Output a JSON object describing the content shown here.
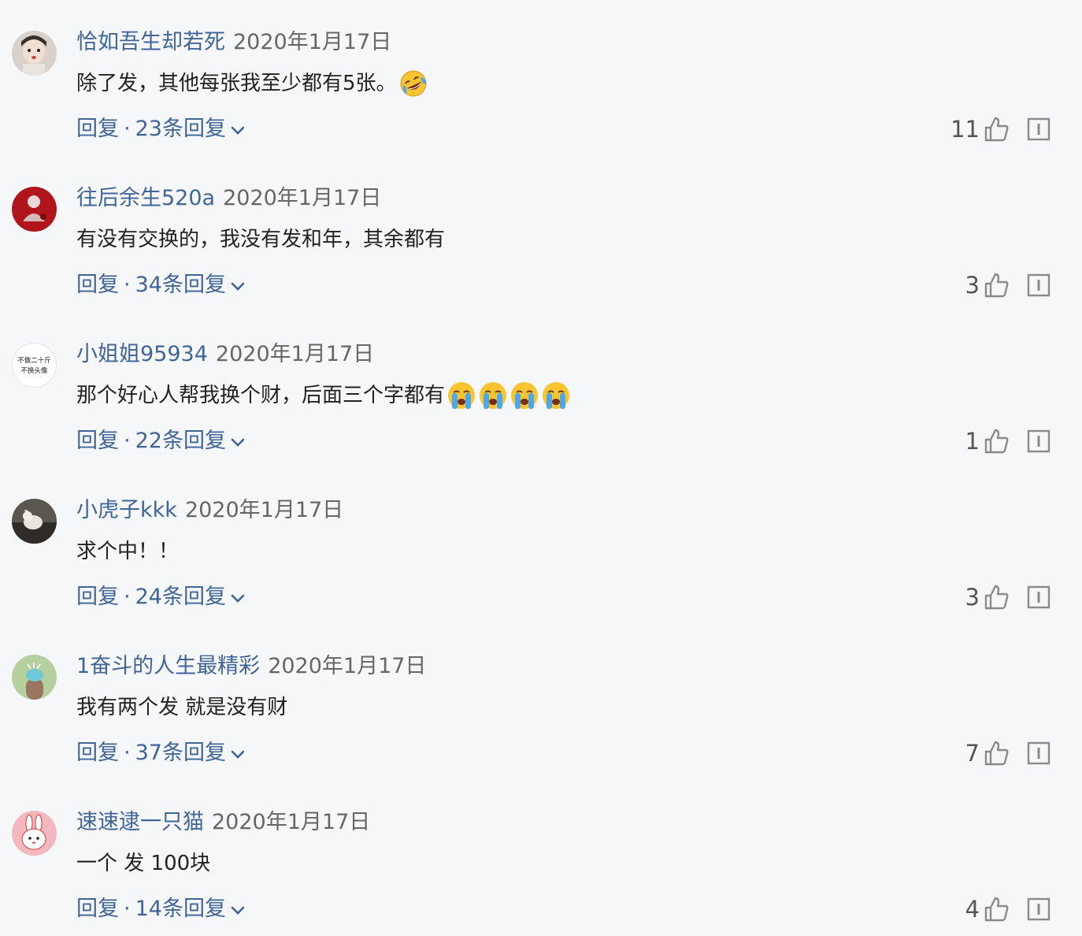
{
  "comments": [
    {
      "username": "恰如吾生却若死",
      "date": "2020年1月17日",
      "text": "除了发，其他每张我至少都有5张。",
      "emojis": [
        "laughing-crying"
      ],
      "reply_label": "回复",
      "reply_count": "23条回复",
      "likes": "11",
      "avatar_color": "#d9d2cc"
    },
    {
      "username": "往后余生520a",
      "date": "2020年1月17日",
      "text": "有没有交换的，我没有发和年，其余都有",
      "emojis": [],
      "reply_label": "回复",
      "reply_count": "34条回复",
      "likes": "3",
      "avatar_color": "#b0151b"
    },
    {
      "username": "小姐姐95934",
      "date": "2020年1月17日",
      "text": "那个好心人帮我换个财，后面三个字都有",
      "emojis": [
        "crying",
        "crying",
        "crying",
        "crying"
      ],
      "reply_label": "回复",
      "reply_count": "22条回复",
      "likes": "1",
      "avatar_text_1": "不做二十斤",
      "avatar_text_2": "不换头像",
      "avatar_color": "#ffffff"
    },
    {
      "username": "小虎子kkk",
      "date": "2020年1月17日",
      "text": "求个中！！",
      "emojis": [],
      "reply_label": "回复",
      "reply_count": "24条回复",
      "likes": "3",
      "avatar_color": "#5a5650"
    },
    {
      "username": "1奋斗的人生最精彩",
      "date": "2020年1月17日",
      "text": "我有两个发 就是没有财",
      "emojis": [],
      "reply_label": "回复",
      "reply_count": "37条回复",
      "likes": "7",
      "avatar_color": "#b6cf9e"
    },
    {
      "username": "速速逮一只猫",
      "date": "2020年1月17日",
      "text": "一个 发 100块",
      "emojis": [],
      "reply_label": "回复",
      "reply_count": "14条回复",
      "likes": "4",
      "avatar_color": "#f3b8be"
    }
  ],
  "separator": "·",
  "colors": {
    "link_blue": "#406599",
    "background": "#f6f7f9",
    "icon_gray": "#8a8a8a"
  }
}
